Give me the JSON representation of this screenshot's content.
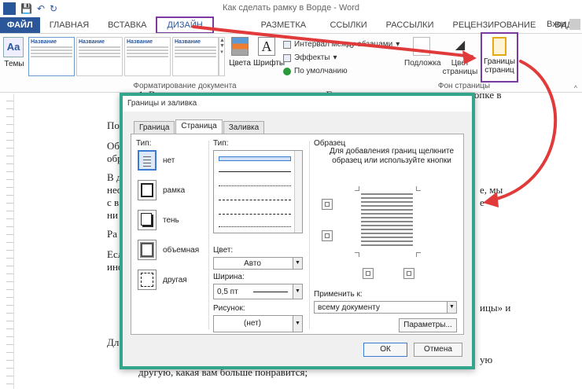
{
  "window": {
    "title": "Как сделать рамку в Ворде - Word",
    "app_icon": "W"
  },
  "quick_access": {
    "save_icon": "💾",
    "undo_icon": "↶",
    "redo_icon": "↻"
  },
  "ribbon_tabs": [
    "ФАЙЛ",
    "ГЛАВНАЯ",
    "ВСТАВКА",
    "ДИЗАЙН",
    "РАЗМЕТКА СТРАНИЦЫ",
    "ССЫЛКИ",
    "РАССЫЛКИ",
    "РЕЦЕНЗИРОВАНИЕ",
    "ВИД"
  ],
  "sign_in": "Вход",
  "ribbon": {
    "themes_label": "Темы",
    "themes_icon": "Aa",
    "gallery": [
      "Название",
      "Название",
      "Название",
      "Название"
    ],
    "colors_label": "Цвета",
    "fonts_label": "Шрифты",
    "fonts_icon": "A",
    "paragraph_spacing": "Интервал между абзацами",
    "effects": "Эффекты",
    "default": "По умолчанию",
    "format_group": "Форматирование документа",
    "watermark": "Подложка",
    "page_color": "Цвет страницы",
    "page_borders": "Границы страниц",
    "page_bg_group": "Фон страницы"
  },
  "document": {
    "lines": [
      "1. В данном разделе находим инструмент «Границы страниц», кликаем по кнопке в",
      "По",
      "Об",
      "обр",
      "В д",
      "нео",
      "с в",
      "ни",
      "Ра",
      "Есл",
      "ино",
      "Дл",
      "другую, какая вам больше понравится;"
    ],
    "right_fragments": [
      "е, мы",
      "е",
      "ицы» и",
      "ую"
    ]
  },
  "dialog": {
    "title": "Границы и заливка",
    "tabs": [
      "Граница",
      "Страница",
      "Заливка"
    ],
    "active_tab": "Страница",
    "type_label": "Тип:",
    "types": [
      "нет",
      "рамка",
      "тень",
      "объемная",
      "другая"
    ],
    "style_label": "Тип:",
    "color_label": "Цвет:",
    "color_value": "Авто",
    "width_label": "Ширина:",
    "width_value": "0,5 пт",
    "art_label": "Рисунок:",
    "art_value": "(нет)",
    "preview_label": "Образец",
    "preview_note": "Для добавления границ щелкните образец или используйте кнопки",
    "apply_label": "Применить к:",
    "apply_value": "всему документу",
    "options_button": "Параметры...",
    "ok_button": "ОК",
    "cancel_button": "Отмена"
  },
  "colors": {
    "accent": "#2b579a",
    "highlight": "#7a3aa0",
    "arrow": "#e03a3a",
    "dialog_border": "#33a58a"
  }
}
